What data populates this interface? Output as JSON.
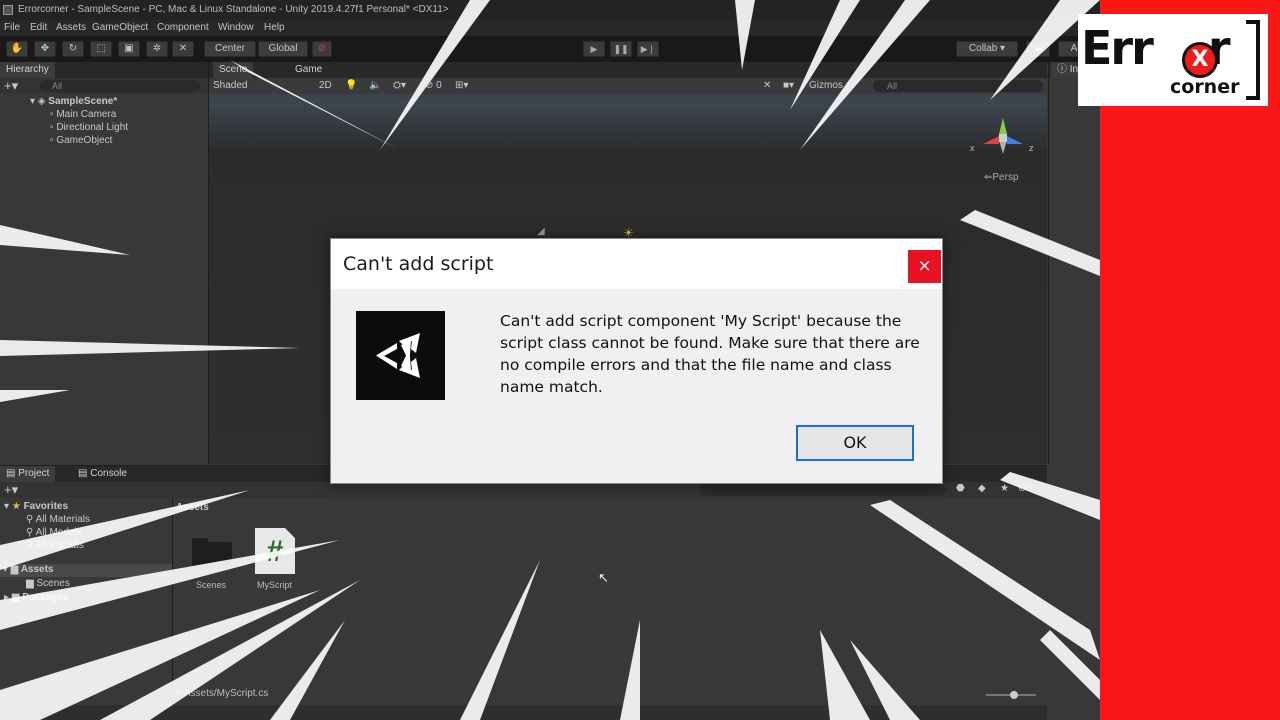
{
  "window": {
    "title": "Errorcorner - SampleScene - PC, Mac & Linux Standalone - Unity 2019.4.27f1 Personal* <DX11>"
  },
  "menu": [
    "File",
    "Edit",
    "Assets",
    "GameObject",
    "Component",
    "Window",
    "Help"
  ],
  "toolbar": {
    "pivot": "Center",
    "space": "Global",
    "collab": "Collab ▾",
    "account": "Acc"
  },
  "hierarchy": {
    "tab": "Hierarchy",
    "search_placeholder": "All",
    "scene": "SampleScene*",
    "items": [
      "Main Camera",
      "Directional Light",
      "GameObject"
    ]
  },
  "scene": {
    "tabs": [
      "Scene",
      "Game"
    ],
    "shading": "Shaded",
    "mode_2d": "2D",
    "fx_count": "0",
    "gizmos": "Gizmos",
    "search_placeholder": "All",
    "persp": "Persp",
    "axis_x": "x",
    "axis_z": "z"
  },
  "inspector": {
    "tab": "Ins"
  },
  "project": {
    "tabs": [
      "Project",
      "Console"
    ],
    "favorites": "Favorites",
    "fav_items": [
      "All Materials",
      "All Models",
      "All Prefabs"
    ],
    "assets_root": "Assets",
    "assets_children": [
      "Scenes"
    ],
    "packages": "Packages",
    "breadcrumb": "Assets",
    "grid_items": [
      "Scenes",
      "MyScript"
    ],
    "hidden_count": "8",
    "status_path": "Assets/MyScript.cs"
  },
  "dialog": {
    "title": "Can't add script",
    "close": "×",
    "message": "Can't add script component 'My Script' because the script class cannot be found. Make sure that there are no compile errors and that the file name and class name match.",
    "ok": "OK"
  },
  "brand": {
    "word": "Err",
    "word_tail": "r",
    "x": "X",
    "sub": "corner",
    "bar_color": "#f81818"
  }
}
